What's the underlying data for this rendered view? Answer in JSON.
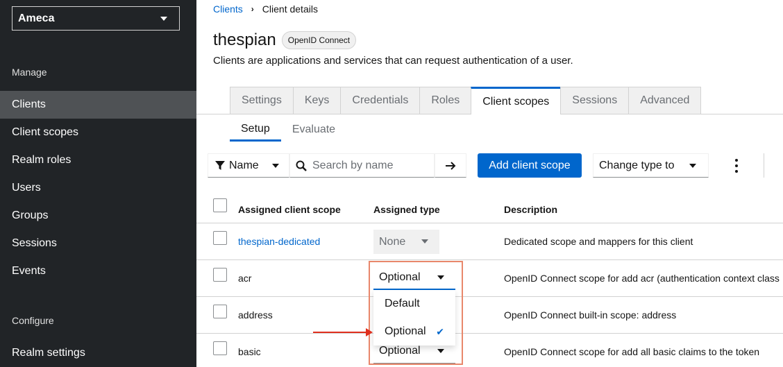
{
  "sidebar": {
    "realm": "Ameca",
    "manage_label": "Manage",
    "items": [
      {
        "label": "Clients"
      },
      {
        "label": "Client scopes"
      },
      {
        "label": "Realm roles"
      },
      {
        "label": "Users"
      },
      {
        "label": "Groups"
      },
      {
        "label": "Sessions"
      },
      {
        "label": "Events"
      }
    ],
    "configure_label": "Configure",
    "configure_items": [
      {
        "label": "Realm settings"
      }
    ]
  },
  "breadcrumb": {
    "root": "Clients",
    "current": "Client details"
  },
  "page": {
    "title": "thespian",
    "badge": "OpenID Connect",
    "description": "Clients are applications and services that can request authentication of a user."
  },
  "tabs": [
    {
      "label": "Settings"
    },
    {
      "label": "Keys"
    },
    {
      "label": "Credentials"
    },
    {
      "label": "Roles"
    },
    {
      "label": "Client scopes"
    },
    {
      "label": "Sessions"
    },
    {
      "label": "Advanced"
    }
  ],
  "subtabs": [
    {
      "label": "Setup"
    },
    {
      "label": "Evaluate"
    }
  ],
  "toolbar": {
    "filter_label": "Name",
    "search_placeholder": "Search by name",
    "add_label": "Add client scope",
    "change_type_label": "Change type to"
  },
  "table": {
    "headers": {
      "scope": "Assigned client scope",
      "type": "Assigned type",
      "description": "Description"
    },
    "rows": [
      {
        "name": "thespian-dedicated",
        "type": "None",
        "description": "Dedicated scope and mappers for this client"
      },
      {
        "name": "acr",
        "type": "Optional",
        "description": "OpenID Connect scope for add acr (authentication context class"
      },
      {
        "name": "address",
        "type": "",
        "description": "OpenID Connect built-in scope: address"
      },
      {
        "name": "basic",
        "type": "Optional",
        "description": "OpenID Connect scope for add all basic claims to the token"
      }
    ]
  },
  "dropdown": {
    "options": [
      {
        "label": "Default"
      },
      {
        "label": "Optional"
      }
    ],
    "selected": "Optional"
  },
  "colors": {
    "accent": "#0066cc",
    "sidebar_bg": "#212427",
    "annotation": "#e0301e"
  }
}
